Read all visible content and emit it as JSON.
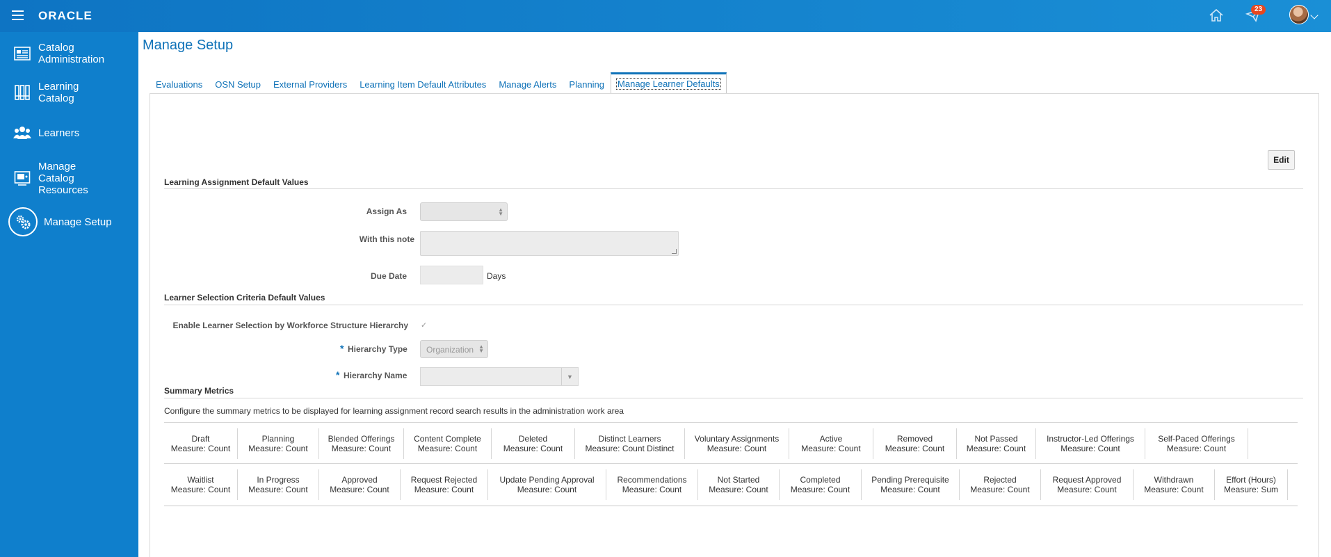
{
  "header": {
    "brand": "ORACLE",
    "notification_count": "23",
    "colors": {
      "bar": "#0e74c3",
      "badge": "#e8471f"
    }
  },
  "sidebar": {
    "items": [
      {
        "label": "Catalog Administration",
        "line1": "Catalog",
        "line2": "Administration",
        "icon": "catalog-admin-icon"
      },
      {
        "label": "Learning Catalog",
        "line1": "Learning",
        "line2": "Catalog",
        "icon": "books-icon"
      },
      {
        "label": "Learners",
        "icon": "people-icon"
      },
      {
        "label": "Manage Catalog Resources",
        "line1": "Manage",
        "line2": "Catalog",
        "line3": "Resources",
        "icon": "resources-icon"
      },
      {
        "label": "Manage Setup",
        "icon": "gears-icon",
        "active": true
      }
    ]
  },
  "page": {
    "title": "Manage Setup",
    "tabs": [
      {
        "label": "Evaluations"
      },
      {
        "label": "OSN Setup"
      },
      {
        "label": "External Providers"
      },
      {
        "label": "Learning Item Default Attributes"
      },
      {
        "label": "Manage Alerts"
      },
      {
        "label": "Planning"
      },
      {
        "label": "Manage Learner Defaults",
        "active": true
      }
    ],
    "edit_label": "Edit"
  },
  "assignment": {
    "heading": "Learning Assignment Default Values",
    "assign_as_label": "Assign As",
    "assign_as_value": "",
    "note_label": "With this note",
    "note_value": "",
    "due_date_label": "Due Date",
    "due_date_value": "",
    "due_date_unit": "Days"
  },
  "selection": {
    "heading": "Learner Selection Criteria Default Values",
    "enable_label": "Enable Learner Selection by Workforce Structure Hierarchy",
    "enable_checked": true,
    "required_mark": "*",
    "hierarchy_type_label": "Hierarchy Type",
    "hierarchy_type_value": "Organization",
    "hierarchy_name_label": "Hierarchy Name",
    "hierarchy_name_value": ""
  },
  "summary": {
    "heading": "Summary Metrics",
    "description": "Configure the summary metrics to be displayed for learning assignment record search results in the administration work area",
    "row1": [
      {
        "name": "Draft",
        "measure": "Measure: Count"
      },
      {
        "name": "Planning",
        "measure": "Measure: Count"
      },
      {
        "name": "Blended Offerings",
        "measure": "Measure: Count"
      },
      {
        "name": "Content Complete",
        "measure": "Measure: Count"
      },
      {
        "name": "Deleted",
        "measure": "Measure: Count"
      },
      {
        "name": "Distinct Learners",
        "measure": "Measure: Count Distinct"
      },
      {
        "name": "Voluntary Assignments",
        "measure": "Measure: Count"
      },
      {
        "name": "Active",
        "measure": "Measure: Count"
      },
      {
        "name": "Removed",
        "measure": "Measure: Count"
      },
      {
        "name": "Not Passed",
        "measure": "Measure: Count"
      },
      {
        "name": "Instructor-Led Offerings",
        "measure": "Measure: Count"
      },
      {
        "name": "Self-Paced Offerings",
        "measure": "Measure: Count"
      }
    ],
    "row2": [
      {
        "name": "Waitlist",
        "measure": "Measure: Count"
      },
      {
        "name": "In Progress",
        "measure": "Measure: Count"
      },
      {
        "name": "Approved",
        "measure": "Measure: Count"
      },
      {
        "name": "Request Rejected",
        "measure": "Measure: Count"
      },
      {
        "name": "Update Pending Approval",
        "measure": "Measure: Count"
      },
      {
        "name": "Recommendations",
        "measure": "Measure: Count"
      },
      {
        "name": "Not Started",
        "measure": "Measure: Count"
      },
      {
        "name": "Completed",
        "measure": "Measure: Count"
      },
      {
        "name": "Pending Prerequisite",
        "measure": "Measure: Count"
      },
      {
        "name": "Rejected",
        "measure": "Measure: Count"
      },
      {
        "name": "Request Approved",
        "measure": "Measure: Count"
      },
      {
        "name": "Withdrawn",
        "measure": "Measure: Count"
      },
      {
        "name": "Effort (Hours)",
        "measure": "Measure: Sum"
      }
    ]
  }
}
